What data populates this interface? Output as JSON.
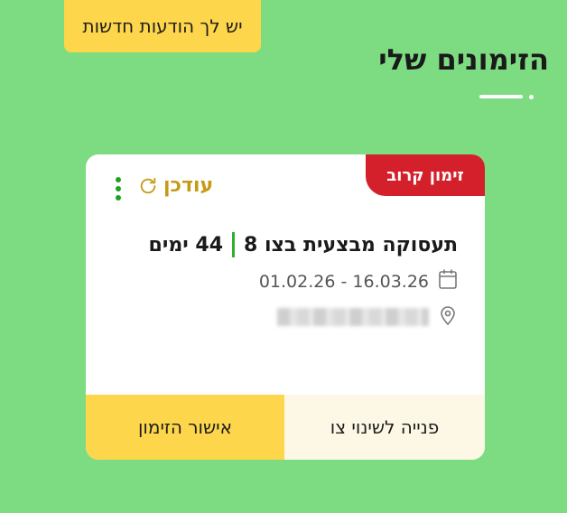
{
  "notifications": {
    "label": "יש לך הודעות חדשות"
  },
  "page": {
    "title": "הזימונים שלי"
  },
  "card": {
    "badge": "זימון קרוב",
    "updated_label": "עודכן",
    "course_name": "תעסוקה מבצעית בצו 8",
    "days": "44 ימים",
    "date_range": "01.02.26 - 16.03.26",
    "location": "",
    "actions": {
      "confirm_label": "אישור הזימון",
      "request_change_label": "פנייה לשינוי צו"
    }
  },
  "colors": {
    "background": "#7ddc82",
    "accent_yellow": "#fdd64b",
    "badge_red": "#d4202a",
    "updated_gold": "#c79a15",
    "divider_green": "#2fb02f"
  },
  "icons": {
    "refresh": "refresh-icon",
    "calendar": "calendar-icon",
    "location": "location-pin-icon",
    "menu": "more-vertical-icon"
  }
}
